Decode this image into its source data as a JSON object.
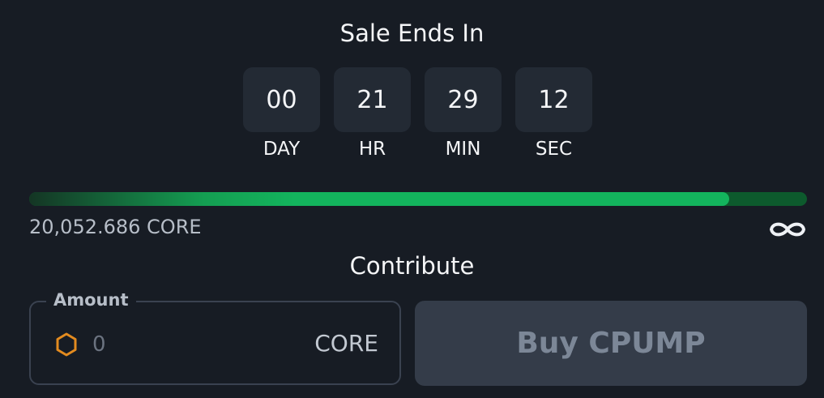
{
  "sale": {
    "title": "Sale Ends In"
  },
  "countdown": [
    {
      "value": "00",
      "label": "DAY"
    },
    {
      "value": "21",
      "label": "HR"
    },
    {
      "value": "29",
      "label": "MIN"
    },
    {
      "value": "12",
      "label": "SEC"
    }
  ],
  "progress": {
    "fraction": 0.9,
    "raised_text": "20,052.686 CORE",
    "cap_icon": "infinity-icon"
  },
  "contribute": {
    "title": "Contribute",
    "amount_label": "Amount",
    "amount_value": "",
    "amount_placeholder": "0",
    "unit": "CORE",
    "token_icon": "hexagon-icon",
    "buy_label": "Buy CPUMP",
    "buy_enabled": false
  },
  "colors": {
    "background": "#171c24",
    "progress_fill": "#13b45d",
    "progress_track": "#0d5a2d",
    "token_icon": "#e38b1f",
    "button_disabled_bg": "#343c49",
    "button_disabled_text": "#7c8797"
  }
}
